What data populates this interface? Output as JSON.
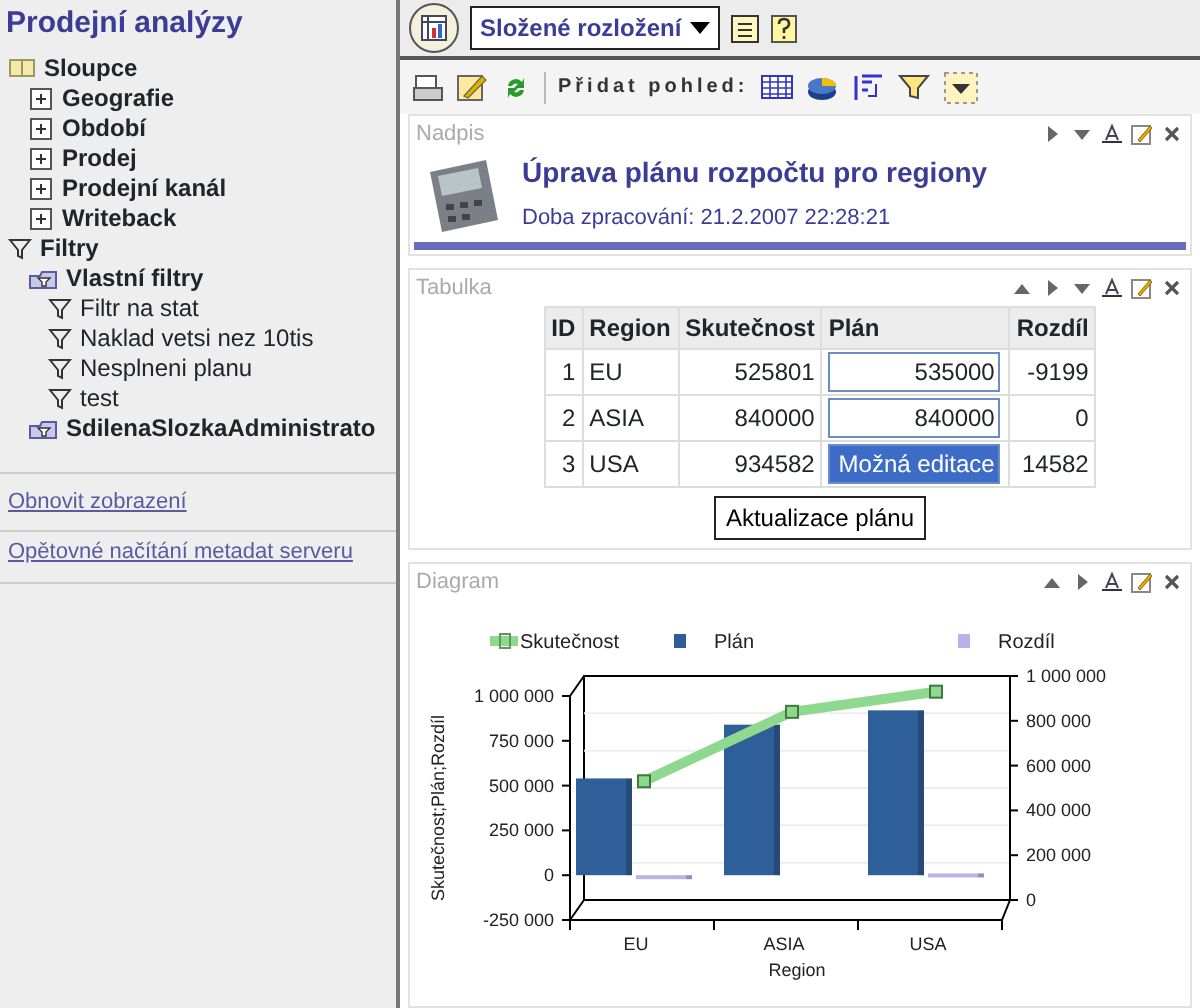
{
  "sidebar": {
    "title": "Prodejní analýzy",
    "tree": [
      {
        "label": "Sloupce",
        "kind": "columns",
        "children": [
          {
            "label": "Geografie",
            "kind": "dimension"
          },
          {
            "label": "Období",
            "kind": "dimension"
          },
          {
            "label": "Prodej",
            "kind": "dimension"
          },
          {
            "label": "Prodejní kanál",
            "kind": "dimension"
          },
          {
            "label": "Writeback",
            "kind": "dimension"
          }
        ]
      },
      {
        "label": "Filtry",
        "kind": "filters",
        "children": [
          {
            "label": "Vlastní filtry",
            "kind": "filter-folder",
            "children": [
              {
                "label": "Filtr na stat",
                "kind": "filter"
              },
              {
                "label": "Naklad vetsi nez 10tis",
                "kind": "filter"
              },
              {
                "label": "Nesplneni planu",
                "kind": "filter"
              },
              {
                "label": "test",
                "kind": "filter"
              }
            ]
          },
          {
            "label": "SdilenaSlozkaAdministrato",
            "kind": "filter-folder"
          }
        ]
      }
    ],
    "links": [
      "Obnovit zobrazení",
      "Opětovné načítání metadat serveru"
    ]
  },
  "toolbar": {
    "layout": "Složené rozložení",
    "add_view_label": "Přidat pohled:"
  },
  "header_panel": {
    "title": "Nadpis",
    "controls": [
      {
        "kind": "right"
      },
      {
        "kind": "down"
      },
      {
        "kind": "format"
      },
      {
        "kind": "edit"
      },
      {
        "kind": "close"
      }
    ],
    "heading": "Úprava plánu rozpočtu pro regiony",
    "subtitle": "Doba zpracování: 21.2.2007 22:28:21"
  },
  "table_panel": {
    "title": "Tabulka",
    "controls": [
      {
        "kind": "up"
      },
      {
        "kind": "right"
      },
      {
        "kind": "down"
      },
      {
        "kind": "format"
      },
      {
        "kind": "edit"
      },
      {
        "kind": "close"
      }
    ],
    "columns": [
      "ID",
      "Region",
      "Skutečnost",
      "Plán",
      "Rozdíl"
    ],
    "rows": [
      {
        "id": "1",
        "region": "EU",
        "actual": "525801",
        "plan": "535000",
        "plan_selected": false,
        "diff": "-9199"
      },
      {
        "id": "2",
        "region": "ASIA",
        "actual": "840000",
        "plan": "840000",
        "plan_selected": false,
        "diff": "0"
      },
      {
        "id": "3",
        "region": "USA",
        "actual": "934582",
        "plan": "Možná editace",
        "plan_selected": true,
        "diff": "14582"
      }
    ],
    "button": "Aktualizace plánu"
  },
  "chart_panel": {
    "title": "Diagram",
    "controls": [
      {
        "kind": "up"
      },
      {
        "kind": "right"
      },
      {
        "kind": "format"
      },
      {
        "kind": "edit"
      },
      {
        "kind": "close"
      }
    ],
    "chart_data": {
      "type": "bar",
      "xlabel": "Region",
      "ylabel": "Skutečnost;Plán;Rozdíl",
      "categories": [
        "EU",
        "ASIA",
        "USA"
      ],
      "series": [
        {
          "name": "Skutečnost",
          "color": "#8fd88f",
          "type": "line",
          "axis": "y2",
          "marker": "square",
          "values": [
            530000,
            840000,
            930000
          ]
        },
        {
          "name": "Plán",
          "color": "#2f5f98",
          "values": [
            540000,
            840000,
            920000
          ]
        },
        {
          "name": "Rozdíl",
          "color": "#b4b4e6",
          "values": [
            -10000,
            0,
            10000
          ]
        }
      ],
      "legend": true,
      "ylim": [
        -250000,
        1000000
      ],
      "yticks": [
        {
          "value": -250000,
          "label": "-250 000"
        },
        {
          "value": 0,
          "label": "0"
        },
        {
          "value": 250000,
          "label": "250 000"
        },
        {
          "value": 500000,
          "label": "500 000"
        },
        {
          "value": 750000,
          "label": "750 000"
        },
        {
          "value": 1000000,
          "label": "1 000 000"
        }
      ],
      "y2lim": [
        0,
        1000000
      ],
      "y2ticks": [
        {
          "value": 0,
          "label": "0"
        },
        {
          "value": 200000,
          "label": "200 000"
        },
        {
          "value": 400000,
          "label": "400 000"
        },
        {
          "value": 600000,
          "label": "600 000"
        },
        {
          "value": 800000,
          "label": "800 000"
        },
        {
          "value": 1000000,
          "label": "1 000 000"
        }
      ]
    }
  }
}
